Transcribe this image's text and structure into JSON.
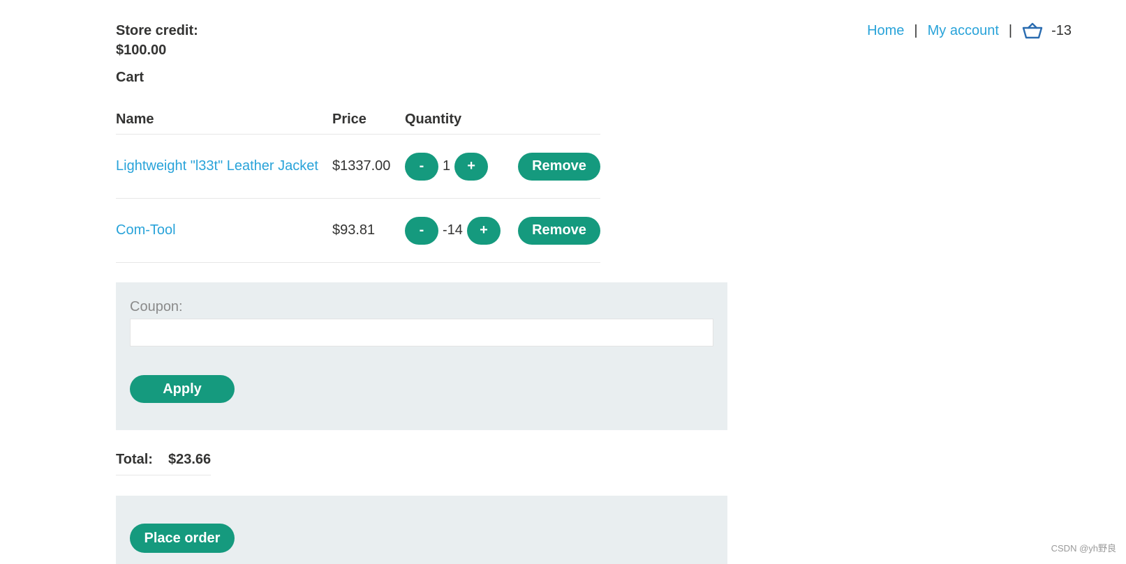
{
  "account": {
    "store_credit_label": "Store credit:",
    "store_credit_value": "$100.00"
  },
  "nav": {
    "home": "Home",
    "my_account": "My account",
    "separator": "|",
    "cart_count": "-13"
  },
  "cart": {
    "title": "Cart",
    "headers": {
      "name": "Name",
      "price": "Price",
      "quantity": "Quantity"
    },
    "items": [
      {
        "name": "Lightweight \"l33t\" Leather Jacket",
        "price": "$1337.00",
        "quantity": "1",
        "minus_label": "-",
        "plus_label": "+",
        "remove_label": "Remove"
      },
      {
        "name": "Com-Tool",
        "price": "$93.81",
        "quantity": "-14",
        "minus_label": "-",
        "plus_label": "+",
        "remove_label": "Remove"
      }
    ]
  },
  "coupon": {
    "label": "Coupon:",
    "value": "",
    "apply_label": "Apply"
  },
  "total": {
    "label": "Total:",
    "value": "$23.66"
  },
  "order": {
    "place_order_label": "Place order"
  },
  "watermark": "CSDN @yh野良",
  "colors": {
    "accent": "#159a7e",
    "link": "#29a3d9",
    "panel": "#e9eef0",
    "text": "#333332"
  }
}
